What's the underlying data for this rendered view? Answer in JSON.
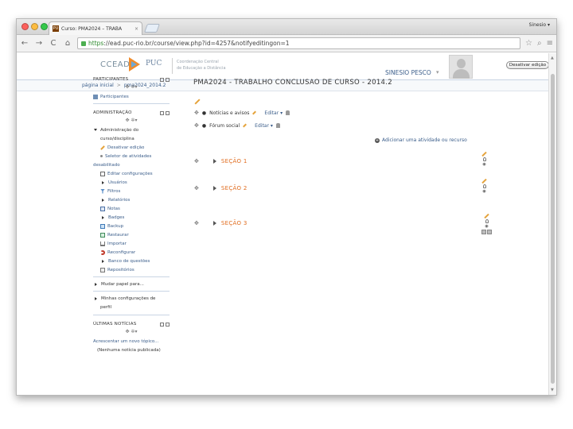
{
  "browser": {
    "tab_title": "Curso: PMA2024 – TRABA",
    "tab_close": "×",
    "favicon": "PU",
    "user_chip": "Sinesio ▾",
    "url_scheme": "https",
    "url_rest": "://ead.puc-rio.br/course/view.php?id=4257&notifyeditingon=1",
    "nav": {
      "back": "←",
      "forward": "→",
      "reload": "C",
      "home": "⌂"
    },
    "star": "☆",
    "search": "⌕",
    "menu": "≡"
  },
  "header": {
    "logo_cce": "CCEAD",
    "logo_puc": "PUC",
    "desc_line1": "Coordenação Central",
    "desc_line2": "de Educação a Distância",
    "user_name": "SINESIO PESCO",
    "user_dropdown": "▾"
  },
  "breadcrumb": {
    "home": "página inicial",
    "sep": ">",
    "course": "pma2024_2014.2"
  },
  "edit_button": "Desativar edição",
  "sidebar": {
    "participants": {
      "title": "PARTICIPANTES",
      "move": "✥ ✲▾",
      "item": "Participantes"
    },
    "admin": {
      "title": "ADMINISTRAÇÃO",
      "move": "✥ ✲▾",
      "root_line1": "Administração do",
      "root_line2": "curso/disciplina",
      "items": [
        "Desativar edição",
        "Seletor de atividades",
        "Editar configurações",
        "Usuários",
        "Filtros",
        "Relatórios",
        "Notas",
        "Badges",
        "Backup",
        "Restaurar",
        "Importar",
        "Reconfigurar",
        "Banco de questões",
        "Repositórios"
      ],
      "selector_sub": "desabilitado",
      "switch_role": "Mudar papel para...",
      "profile_line1": "Minhas configurações de",
      "profile_line2": "perfil"
    },
    "news": {
      "title": "ÚLTIMAS NOTÍCIAS",
      "move": "✥ ✲▾",
      "add_topic": "Acrescentar um novo tópico...",
      "none": "(Nenhuma notícia publicada)"
    }
  },
  "course": {
    "title": "PMA2024 - TRABALHO CONCLUSAO DE CURSO - 2014.2",
    "activities": [
      {
        "label": "Notícias e avisos",
        "edit": "Editar ▾"
      },
      {
        "label": "Fórum social",
        "edit": "Editar ▾"
      }
    ],
    "add_activity": "Adicionar uma atividade ou recurso",
    "sections": [
      "SEÇÃO 1",
      "SEÇÃO 2",
      "SEÇÃO 3"
    ],
    "move_icon": "✥",
    "eye_icon": "◉"
  },
  "colors": {
    "link": "#3a5d8a",
    "section_title": "#e06c1f",
    "pencil": "#e5a33b"
  }
}
